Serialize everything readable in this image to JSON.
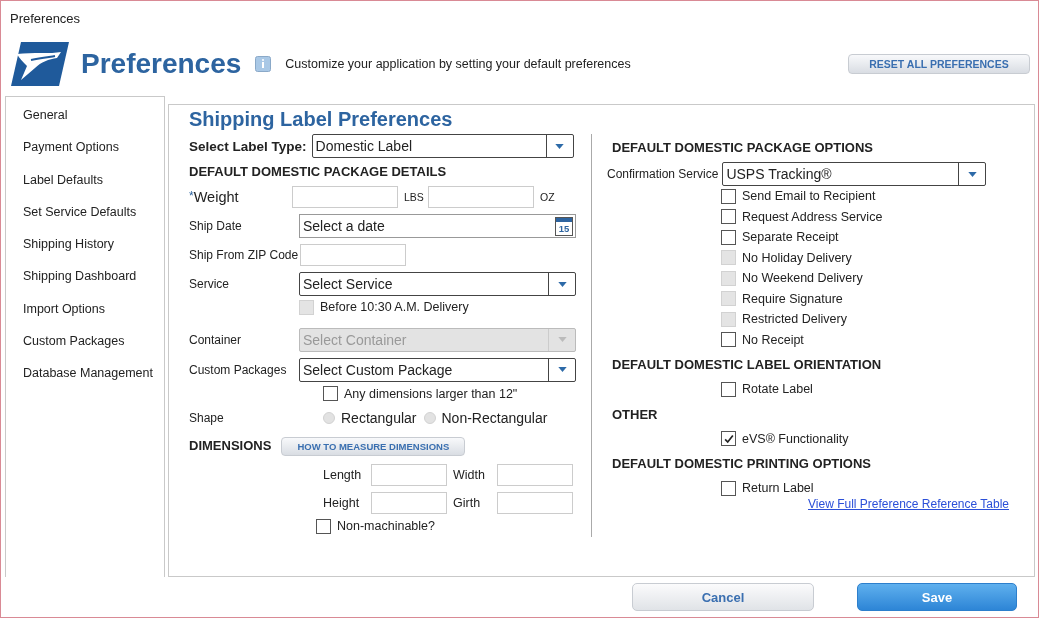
{
  "window": {
    "title": "Preferences"
  },
  "header": {
    "title": "Preferences",
    "description": "Customize your application by setting your default preferences",
    "reset_button": "RESET ALL PREFERENCES"
  },
  "sidebar": {
    "items": [
      {
        "label": "General",
        "selected": false
      },
      {
        "label": "Payment Options",
        "selected": false
      },
      {
        "label": "Label Defaults",
        "selected": false
      },
      {
        "label": "Set Service Defaults",
        "selected": false
      },
      {
        "label": "Shipping History",
        "selected": false
      },
      {
        "label": "Shipping Dashboard",
        "selected": false
      },
      {
        "label": "Import Options",
        "selected": false
      },
      {
        "label": "Custom Packages",
        "selected": false
      },
      {
        "label": "Database Management",
        "selected": false
      }
    ]
  },
  "panel": {
    "title": "Shipping Label Preferences",
    "label_type": {
      "label": "Select Label Type:",
      "value": "Domestic Label"
    },
    "package_details": {
      "heading": "DEFAULT DOMESTIC PACKAGE DETAILS",
      "weight": {
        "required_mark": "*",
        "label": "Weight",
        "unit_1": "LBS",
        "unit_2": "OZ"
      },
      "ship_date": {
        "label": "Ship Date",
        "placeholder": "Select a date",
        "calendar_day": "15"
      },
      "zip": {
        "label": "Ship From ZIP Code"
      },
      "service": {
        "label": "Service",
        "value": "Select Service",
        "disabled": false
      },
      "before_1030": {
        "label": "Before 10:30 A.M. Delivery",
        "checked": false,
        "disabled": true
      },
      "container": {
        "label": "Container",
        "value": "Select Container",
        "disabled": true
      },
      "custom_packages": {
        "label": "Custom Packages",
        "value": "Select Custom Package",
        "disabled": false
      },
      "large_dimensions": {
        "label": "Any dimensions larger than 12\"",
        "checked": false,
        "disabled": false
      },
      "shape": {
        "label": "Shape",
        "options": [
          {
            "label": "Rectangular",
            "selected": false,
            "disabled": true
          },
          {
            "label": "Non-Rectangular",
            "selected": false,
            "disabled": true
          }
        ]
      }
    },
    "dimensions": {
      "heading": "DIMENSIONS",
      "help_button": "HOW TO MEASURE DIMENSIONS",
      "fields": [
        {
          "label": "Length"
        },
        {
          "label": "Width"
        },
        {
          "label": "Height"
        },
        {
          "label": "Girth"
        }
      ],
      "non_machinable": {
        "label": "Non-machinable?",
        "checked": false,
        "disabled": false
      }
    },
    "package_options": {
      "heading": "DEFAULT DOMESTIC PACKAGE OPTIONS",
      "confirmation": {
        "label": "Confirmation Service",
        "value": "USPS Tracking®"
      },
      "options": [
        {
          "label": "Send Email to Recipient",
          "checked": false,
          "disabled": false
        },
        {
          "label": "Request Address Service",
          "checked": false,
          "disabled": false
        },
        {
          "label": "Separate Receipt",
          "checked": false,
          "disabled": false
        },
        {
          "label": "No Holiday Delivery",
          "checked": false,
          "disabled": true
        },
        {
          "label": "No Weekend Delivery",
          "checked": false,
          "disabled": true
        },
        {
          "label": "Require Signature",
          "checked": false,
          "disabled": true
        },
        {
          "label": "Restricted Delivery",
          "checked": false,
          "disabled": true
        },
        {
          "label": "No Receipt",
          "checked": false,
          "disabled": false
        }
      ]
    },
    "sections": [
      {
        "heading": "DEFAULT DOMESTIC LABEL ORIENTATION",
        "options": [
          {
            "label": "Rotate Label",
            "checked": false,
            "disabled": false
          }
        ]
      },
      {
        "heading": "OTHER",
        "options": [
          {
            "label": "eVS® Functionality",
            "checked": true,
            "disabled": false
          }
        ]
      },
      {
        "heading": "DEFAULT DOMESTIC PRINTING OPTIONS",
        "options": [
          {
            "label": "Return Label",
            "checked": false,
            "disabled": false
          }
        ]
      }
    ],
    "reference_link": "View Full Preference Reference Table"
  },
  "footer": {
    "cancel_button": "Cancel",
    "save_button": "Save"
  }
}
